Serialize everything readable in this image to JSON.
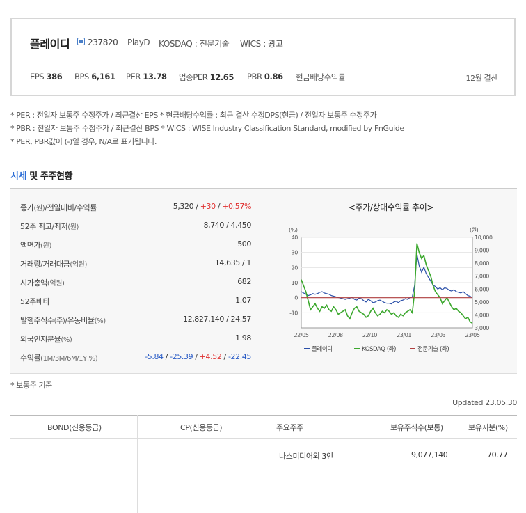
{
  "company": {
    "name": "플레이디",
    "code": "237820",
    "english_name": "PlayD",
    "market": "KOSDAQ : 전문기술",
    "wics": "WICS : 광고",
    "market_icon": "kosdaq-market-icon"
  },
  "metrics": [
    {
      "label": "EPS",
      "value": "386"
    },
    {
      "label": "BPS",
      "value": "6,161"
    },
    {
      "label": "PER",
      "value": "13.78"
    },
    {
      "label": "업종PER",
      "value": "12.65"
    },
    {
      "label": "PBR",
      "value": "0.86"
    },
    {
      "label": "현금배당수익률",
      "value": ""
    }
  ],
  "settlement": "12월 결산",
  "notes": [
    "* PER : 전일자 보통주 수정주가 / 최근결산 EPS * 현금배당수익률 : 최근 결산 수정DPS(현금) / 전일자 보통주 수정주가",
    "* PBR : 전일자 보통주 수정주가 / 최근결산 BPS * WICS : WISE Industry Classification Standard, modified by FnGuide",
    "* PER, PBR값이 (-)일 경우, N/A로 표기됩니다."
  ],
  "section": {
    "title_a": "시세",
    "title_b": " 및 주주현황"
  },
  "market_rows": [
    {
      "label": "종가",
      "unit": "(원)",
      "label2": "/전일대비/수익률",
      "v1": "5,320",
      "v2": "+30",
      "v3": "+0.57%"
    },
    {
      "label": "52주 최고/최저",
      "unit": "(원)",
      "value": "8,740 / 4,450"
    },
    {
      "label": "액면가",
      "unit": "(원)",
      "value": "500"
    },
    {
      "label": "거래량/거래대금",
      "unit": "(억원)",
      "value": "14,635 / 1"
    },
    {
      "label": "시가총액",
      "unit": "(억원)",
      "value": "682"
    },
    {
      "label": "52주베타",
      "unit": "",
      "value": "1.07"
    },
    {
      "label": "발행주식수",
      "unit": "(주)",
      "label2": "/유동비율",
      "unit2": "(%)",
      "value": "12,827,140 / 24.57"
    },
    {
      "label": "외국인지분율",
      "unit": "(%)",
      "value": "1.98"
    },
    {
      "label": "수익률",
      "unit": "(1M/3M/6M/1Y,%)",
      "r1": "-5.84",
      "r2": "-25.39",
      "r3": "+4.52",
      "r4": "-22.45"
    }
  ],
  "chart_title": "<주가/상대수익률 추이>",
  "chart_data": {
    "type": "line",
    "left_axis_unit": "(%)",
    "right_axis_unit": "(원)",
    "left_ticks": [
      "40",
      "30",
      "20",
      "10",
      "0",
      "-10"
    ],
    "right_ticks": [
      "10,000",
      "9,000",
      "8,000",
      "7,000",
      "6,000",
      "5,000",
      "4,000",
      "3,000"
    ],
    "x_ticks": [
      "22/05",
      "22/08",
      "22/10",
      "23/01",
      "23/03",
      "23/05"
    ],
    "ylim_left": [
      -20,
      40
    ],
    "ylim_right": [
      3000,
      10000
    ],
    "series": [
      {
        "name": "플레이디",
        "axis": "right",
        "color": "#2a4fa8",
        "values": [
          5800,
          5700,
          5600,
          5500,
          5550,
          5650,
          5600,
          5650,
          5750,
          5800,
          5700,
          5650,
          5600,
          5500,
          5450,
          5400,
          5350,
          5300,
          5250,
          5200,
          5250,
          5300,
          5350,
          5200,
          5150,
          5300,
          5250,
          5100,
          5000,
          5200,
          5100,
          4950,
          5000,
          5100,
          5150,
          5050,
          4950,
          4900,
          4900,
          4850,
          5000,
          5050,
          4950,
          5100,
          5150,
          5250,
          5200,
          5350,
          5400,
          6300,
          8700,
          7800,
          7300,
          7700,
          7200,
          6900,
          6600,
          6300,
          6200,
          6000,
          6100,
          5950,
          6100,
          6050,
          5900,
          5850,
          5950,
          5800,
          5750,
          5700,
          5800,
          5650,
          5500,
          5450,
          5320
        ]
      },
      {
        "name": "KOSDAQ (좌)",
        "axis": "left",
        "color": "#3ca82e",
        "values": [
          12,
          8,
          4,
          -2,
          -8,
          -6,
          -4,
          -7,
          -9,
          -6,
          -7,
          -5,
          -8,
          -9,
          -6,
          -8,
          -11,
          -10,
          -9,
          -8,
          -12,
          -14,
          -10,
          -7,
          -6,
          -9,
          -10,
          -11,
          -13,
          -12,
          -9,
          -7,
          -10,
          -12,
          -11,
          -9,
          -10,
          -8,
          -9,
          -11,
          -10,
          -12,
          -13,
          -11,
          -12,
          -10,
          -9,
          -8,
          -10,
          4,
          36,
          30,
          26,
          28,
          22,
          18,
          14,
          8,
          4,
          2,
          0,
          -4,
          -2,
          0,
          -3,
          -6,
          -8,
          -7,
          -9,
          -10,
          -12,
          -14,
          -13,
          -16,
          -17
        ]
      },
      {
        "name": "전문기술 (좌)",
        "axis": "left",
        "color": "#b04040",
        "values": [
          0,
          0,
          0,
          0,
          0,
          0,
          0,
          0,
          0,
          0,
          0,
          0,
          0,
          0,
          0,
          0,
          0,
          0,
          0,
          0,
          0,
          0,
          0,
          0,
          0,
          0,
          0,
          0,
          0,
          0,
          0,
          0,
          0,
          0,
          0,
          0,
          0,
          0,
          0,
          0,
          0,
          0,
          0,
          0,
          0,
          0,
          0,
          0,
          0,
          0,
          0,
          0,
          0,
          0,
          0,
          0,
          0,
          0,
          0,
          0,
          0,
          0,
          0,
          0,
          0,
          0,
          0,
          0,
          0,
          0,
          0,
          0,
          0,
          0,
          0
        ]
      }
    ]
  },
  "footnote": "* 보통주 기준",
  "updated": "Updated 23.05.30",
  "bottom": {
    "bond_header": "BOND(신용등급)",
    "cp_header": "CP(신용등급)",
    "holder_header": "주요주주",
    "shares_header": "보유주식수(보통)",
    "stake_header": "보유지분(%)",
    "holder": "나스미디어외 3인",
    "shares": "9,077,140",
    "stake": "70.77"
  }
}
